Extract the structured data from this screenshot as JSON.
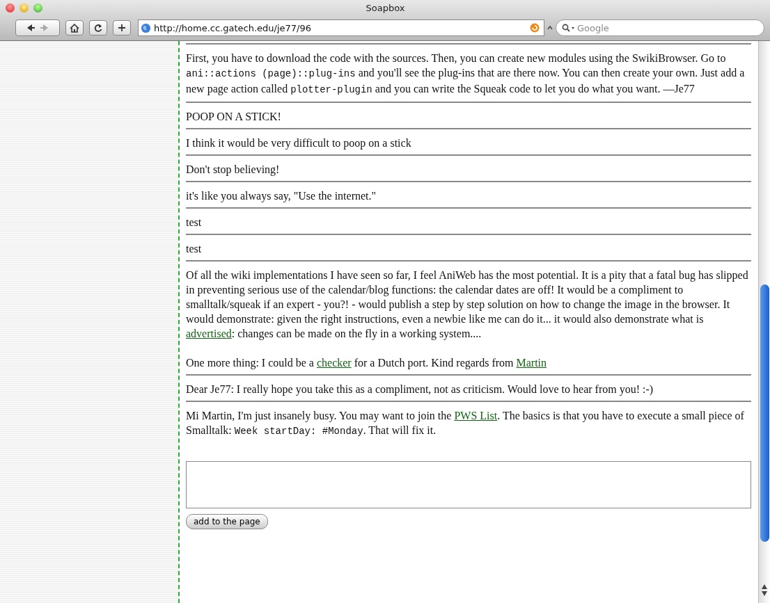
{
  "window": {
    "title": "Soapbox"
  },
  "toolbar": {
    "url": "http://home.cc.gatech.edu/je77/96",
    "search": {
      "placeholder": "Google"
    }
  },
  "posts": [
    {
      "paragraphs": [
        [
          {
            "kind": "text",
            "text": "First, you have to download the code with the sources. Then, you can create new modules using the SwikiBrowser. Go to "
          },
          {
            "kind": "code",
            "text": "ani::actions (page)::plug-ins"
          },
          {
            "kind": "text",
            "text": " and you'll see the plug-ins that are there now. You can then create your own. Just add a new page action called "
          },
          {
            "kind": "code",
            "text": "plotter-plugin"
          },
          {
            "kind": "text",
            "text": " and you can write the Squeak code to let you do what you want. —Je77"
          }
        ]
      ]
    },
    {
      "paragraphs": [
        [
          {
            "kind": "text",
            "text": "POOP ON A STICK!"
          }
        ]
      ]
    },
    {
      "paragraphs": [
        [
          {
            "kind": "text",
            "text": "I think it would be very difficult to poop on a stick"
          }
        ]
      ]
    },
    {
      "paragraphs": [
        [
          {
            "kind": "text",
            "text": "Don't stop believing!"
          }
        ]
      ]
    },
    {
      "paragraphs": [
        [
          {
            "kind": "text",
            "text": "it's like you always say, \"Use the internet.\""
          }
        ]
      ]
    },
    {
      "paragraphs": [
        [
          {
            "kind": "text",
            "text": "test"
          }
        ]
      ]
    },
    {
      "paragraphs": [
        [
          {
            "kind": "text",
            "text": "test"
          }
        ]
      ]
    },
    {
      "paragraphs": [
        [
          {
            "kind": "text",
            "text": "Of all the wiki implementations I have seen so far, I feel AniWeb has the most potential. It is a pity that a fatal bug has slipped in preventing serious use of the calendar/blog functions: the calendar dates are off! It would be a compliment to smalltalk/squeak if an expert - you?! - would publish a step by step solution on how to change the image in the browser. It would demonstrate: given the right instructions, even a newbie like me can do it... it would also demonstrate what is "
          },
          {
            "kind": "link",
            "text": "advertised"
          },
          {
            "kind": "text",
            "text": ": changes can be made on the fly in a working system...."
          }
        ],
        [
          {
            "kind": "text",
            "text": "One more thing: I could be a "
          },
          {
            "kind": "link",
            "text": "checker"
          },
          {
            "kind": "text",
            "text": " for a Dutch port. Kind regards from "
          },
          {
            "kind": "link",
            "text": "Martin"
          }
        ]
      ]
    },
    {
      "paragraphs": [
        [
          {
            "kind": "text",
            "text": "Dear Je77: I really hope you take this as a compliment, not as criticism. Would love to hear from you! :-)"
          }
        ]
      ]
    },
    {
      "paragraphs": [
        [
          {
            "kind": "text",
            "text": "Mi Martin, I'm just insanely busy. You may want to join the "
          },
          {
            "kind": "link",
            "text": "PWS List"
          },
          {
            "kind": "text",
            "text": ". The basics is that you have to execute a small piece of Smalltalk: "
          },
          {
            "kind": "code",
            "text": "Week startDay: #Monday"
          },
          {
            "kind": "text",
            "text": ". That will fix it."
          }
        ]
      ]
    }
  ],
  "form": {
    "button": "add to the page"
  }
}
